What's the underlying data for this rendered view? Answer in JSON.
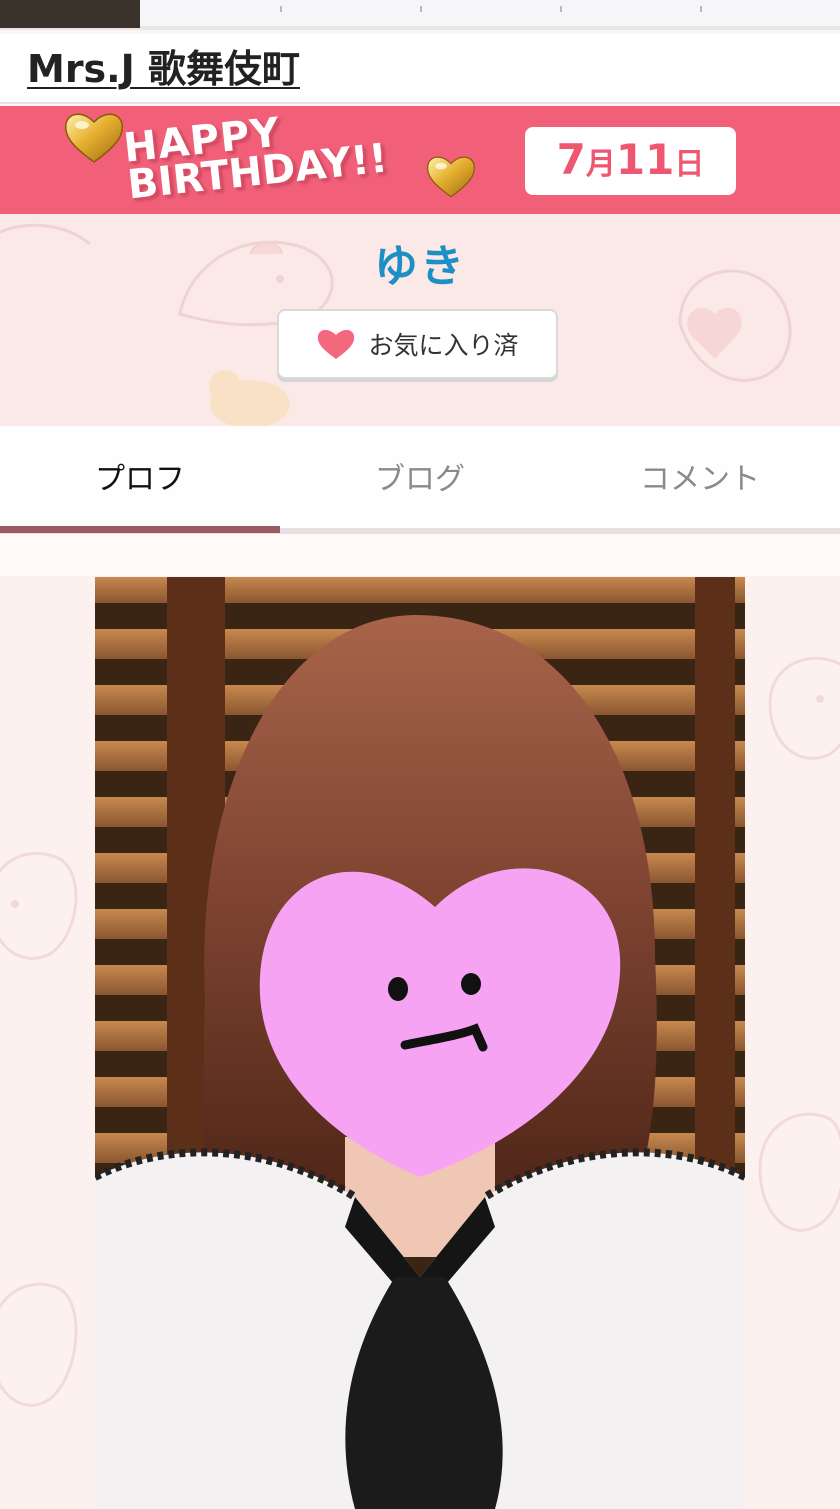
{
  "header": {
    "site_title": "Mrs.J 歌舞伎町"
  },
  "banner": {
    "line1": "HAPPY",
    "line2": "BIRTHDAY!!",
    "date_month_num": "7",
    "date_month_unit": "月",
    "date_day_num": "11",
    "date_day_unit": "日"
  },
  "profile": {
    "name": "ゆき",
    "favorite_label": "お気に入り済"
  },
  "tabs": [
    {
      "label": "プロフ",
      "active": true
    },
    {
      "label": "ブログ",
      "active": false
    },
    {
      "label": "コメント",
      "active": false
    }
  ],
  "colors": {
    "banner": "#f25f78",
    "name": "#1d8fc4",
    "heart": "#f4687e",
    "tab_indicator": "#9b5a61",
    "face_cover": "#f7a3f4"
  },
  "icons": {
    "favorite": "heart-icon",
    "banner_deco": "gold-heart-icon"
  }
}
